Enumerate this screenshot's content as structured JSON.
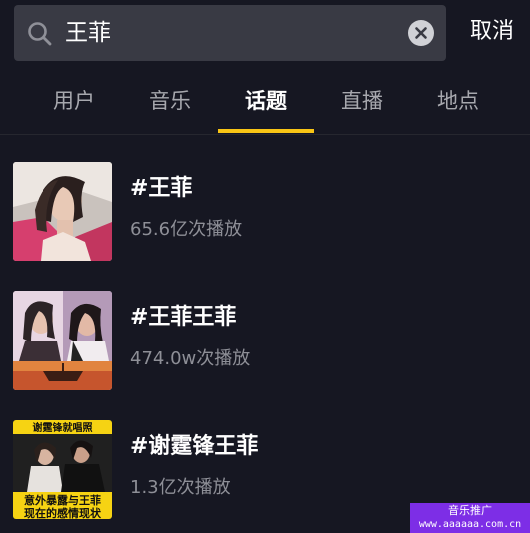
{
  "search": {
    "query": "王菲",
    "cancel_label": "取消"
  },
  "tabs": [
    {
      "label": "用户",
      "active": false
    },
    {
      "label": "音乐",
      "active": false
    },
    {
      "label": "话题",
      "active": true
    },
    {
      "label": "直播",
      "active": false
    },
    {
      "label": "地点",
      "active": false
    }
  ],
  "results": [
    {
      "title": "#王菲",
      "views": "65.6亿次播放"
    },
    {
      "title": "#王菲王菲",
      "views": "474.0w次播放"
    },
    {
      "title": "#谢霆锋王菲",
      "views": "1.3亿次播放"
    }
  ],
  "thumb3": {
    "top_caption": "谢霆锋就唱照",
    "bottom_line1": "意外暴露与王菲",
    "bottom_line2": "现在的感情现状"
  },
  "watermark": {
    "line1": "音乐推广",
    "line2": "www.aaaaaa.com.cn"
  },
  "colors": {
    "background": "#161722",
    "search_box": "#393a44",
    "accent_underline": "#f9c515",
    "watermark": "#7d2ee6"
  }
}
